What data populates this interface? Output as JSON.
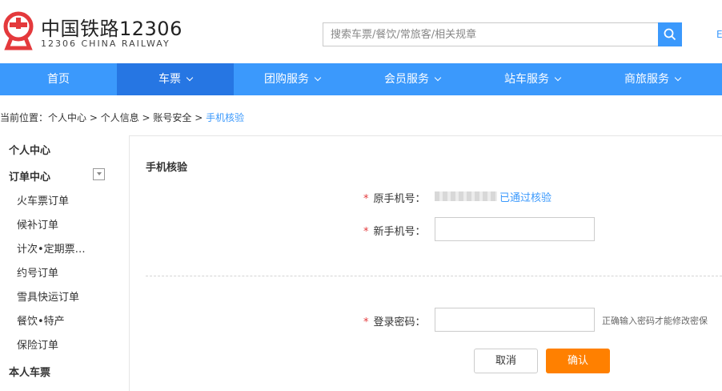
{
  "header": {
    "title": "中国铁路12306",
    "subtitle": "12306 CHINA RAILWAY",
    "search_placeholder": "搜索车票/餐饮/常旅客/相关规章",
    "extra": "E"
  },
  "nav": {
    "items": [
      {
        "label": "首页",
        "dropdown": false
      },
      {
        "label": "车票",
        "dropdown": true,
        "active": true
      },
      {
        "label": "团购服务",
        "dropdown": true
      },
      {
        "label": "会员服务",
        "dropdown": true
      },
      {
        "label": "站车服务",
        "dropdown": true
      },
      {
        "label": "商旅服务",
        "dropdown": true
      }
    ]
  },
  "breadcrumb": {
    "prefix": "当前位置：",
    "items": [
      "个人中心",
      "个人信息",
      "账号安全"
    ],
    "separator": " > ",
    "current": "手机核验"
  },
  "sidebar": {
    "personal_center": "个人中心",
    "order_center": "订单中心",
    "order_items": [
      "火车票订单",
      "候补订单",
      "计次•定期票…",
      "约号订单",
      "雪具快运订单",
      "餐饮•特产",
      "保险订单"
    ],
    "my_tickets": "本人车票"
  },
  "form": {
    "title": "手机核验",
    "required_mark": "*",
    "old_phone_label": "原手机号：",
    "old_phone_status": "已通过核验",
    "new_phone_label": "新手机号：",
    "new_phone_value": "",
    "password_label": "登录密码：",
    "password_value": "",
    "password_hint": "正确输入密码才能修改密保",
    "cancel_label": "取消",
    "confirm_label": "确认"
  },
  "colors": {
    "primary": "#3b99fc",
    "nav_active": "#2676e3",
    "confirm": "#ff8000",
    "required": "#e4393c",
    "logo": "#e4393c"
  }
}
